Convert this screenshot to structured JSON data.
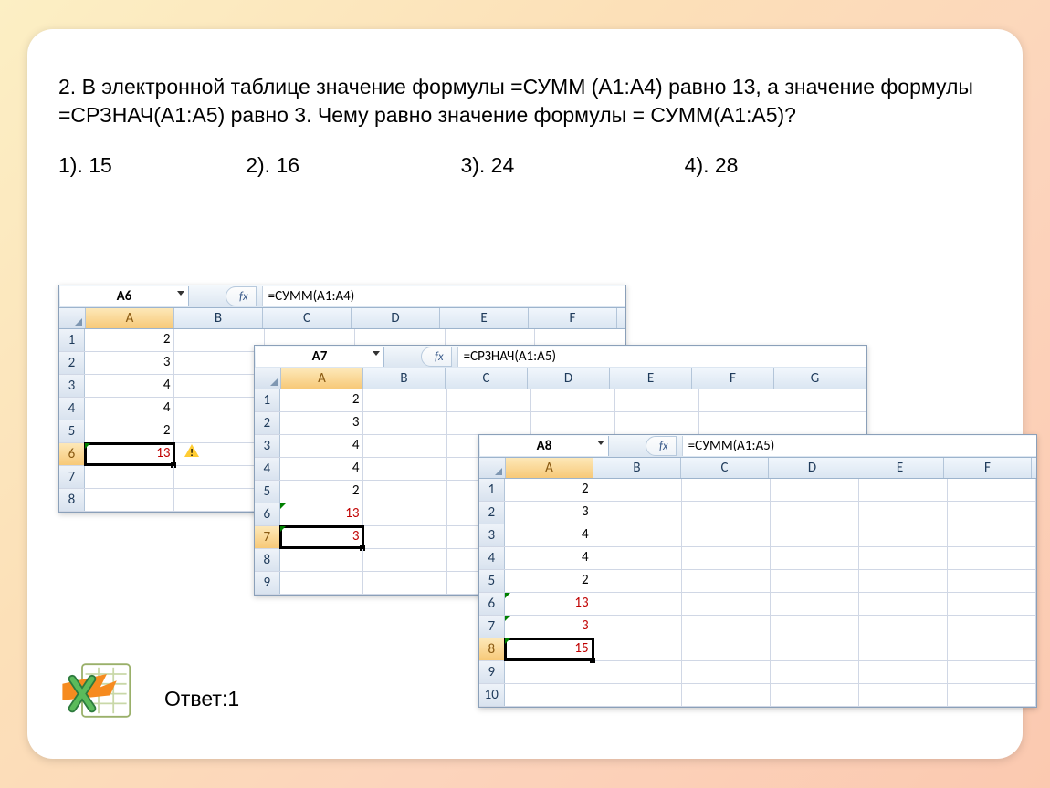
{
  "question": "2. В электронной таблице значение формулы  =СУММ (А1:А4) равно 13, а значение формулы =СРЗНАЧ(А1:А5) равно 3. Чему равно значение формулы = СУММ(А1:А5)?",
  "options": {
    "o1": "1). 15",
    "o2": "2). 16",
    "o3": "3). 24",
    "o4": "4). 28"
  },
  "answer": "Ответ:1",
  "excel1": {
    "namebox": "A6",
    "fx": "fx",
    "formula": "=СУММ(A1:A4)",
    "cols": [
      "A",
      "B",
      "C",
      "D",
      "E",
      "F"
    ],
    "rows": [
      {
        "n": "1",
        "A": "2"
      },
      {
        "n": "2",
        "A": "3"
      },
      {
        "n": "3",
        "A": "4"
      },
      {
        "n": "4",
        "A": "4"
      },
      {
        "n": "5",
        "A": "2"
      },
      {
        "n": "6",
        "A": "13",
        "red": true,
        "selected": true,
        "warn": true,
        "tick": true
      },
      {
        "n": "7",
        "A": ""
      },
      {
        "n": "8",
        "A": ""
      }
    ]
  },
  "excel2": {
    "namebox": "A7",
    "fx": "fx",
    "formula": "=СРЗНАЧ(A1:A5)",
    "cols": [
      "A",
      "B",
      "C",
      "D",
      "E",
      "F",
      "G"
    ],
    "rows": [
      {
        "n": "1",
        "A": "2"
      },
      {
        "n": "2",
        "A": "3"
      },
      {
        "n": "3",
        "A": "4"
      },
      {
        "n": "4",
        "A": "4"
      },
      {
        "n": "5",
        "A": "2"
      },
      {
        "n": "6",
        "A": "13",
        "red": true,
        "tick": true
      },
      {
        "n": "7",
        "A": "3",
        "red": true,
        "selected": true,
        "tick": true
      },
      {
        "n": "8",
        "A": ""
      },
      {
        "n": "9",
        "A": ""
      }
    ]
  },
  "excel3": {
    "namebox": "A8",
    "fx": "fx",
    "formula": "=СУММ(A1:A5)",
    "cols": [
      "A",
      "B",
      "C",
      "D",
      "E",
      "F"
    ],
    "rows": [
      {
        "n": "1",
        "A": "2"
      },
      {
        "n": "2",
        "A": "3"
      },
      {
        "n": "3",
        "A": "4"
      },
      {
        "n": "4",
        "A": "4"
      },
      {
        "n": "5",
        "A": "2"
      },
      {
        "n": "6",
        "A": "13",
        "red": true,
        "tick": true
      },
      {
        "n": "7",
        "A": "3",
        "red": true,
        "tick": true
      },
      {
        "n": "8",
        "A": "15",
        "red": true,
        "selected": true,
        "tick": true
      },
      {
        "n": "9",
        "A": ""
      },
      {
        "n": "10",
        "A": ""
      }
    ]
  }
}
